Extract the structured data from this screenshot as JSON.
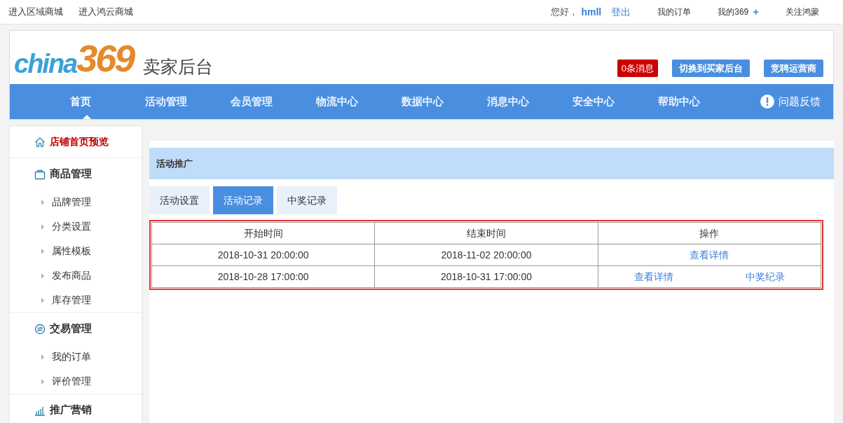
{
  "top_bar": {
    "left_links": [
      "进入区域商城",
      "进入鸿云商城"
    ],
    "greeting": "您好，",
    "username": "hmll",
    "logout": "登出",
    "right_links": [
      {
        "label": "我的订单",
        "plus": false
      },
      {
        "label": "我的369",
        "plus": true
      },
      {
        "label": "关注鸿蒙",
        "plus": false
      }
    ],
    "plus_text": "+"
  },
  "header": {
    "logo": {
      "part_1": "china",
      "part_2": "369"
    },
    "title": "卖家后台",
    "messages": "0条消息",
    "buttons": [
      "切换到买家后台",
      "竞聘运营商"
    ]
  },
  "nav": {
    "items": [
      {
        "label": "首页",
        "selected": true
      },
      {
        "label": "活动管理",
        "selected": false
      },
      {
        "label": "会员管理",
        "selected": false
      },
      {
        "label": "物流中心",
        "selected": false
      },
      {
        "label": "数据中心",
        "selected": false
      },
      {
        "label": "消息中心",
        "selected": false
      },
      {
        "label": "安全中心",
        "selected": false
      },
      {
        "label": "帮助中心",
        "selected": false
      }
    ],
    "feedback": "问题反馈"
  },
  "sidebar": {
    "sections": [
      {
        "kind": "home",
        "label": "店铺首页预览",
        "highlight": true
      },
      {
        "kind": "goods",
        "label": "商品管理",
        "highlight": false,
        "children": [
          "品牌管理",
          "分类设置",
          "属性模板",
          "发布商品",
          "库存管理"
        ]
      },
      {
        "kind": "trade",
        "label": "交易管理",
        "highlight": false,
        "children": [
          "我的订单",
          "评价管理"
        ]
      },
      {
        "kind": "promotion",
        "label": "推广营销",
        "highlight": false
      }
    ]
  },
  "panel": {
    "title": "活动推广",
    "tabs": [
      {
        "label": "活动设置",
        "selected": false
      },
      {
        "label": "活动记录",
        "selected": true
      },
      {
        "label": "中奖记录",
        "selected": false
      }
    ],
    "table": {
      "columns": [
        "开始时间",
        "结束时间",
        "操作"
      ],
      "rows": [
        {
          "start": "2018-10-31 20:00:00",
          "end": "2018-11-02 20:00:00",
          "actions": [
            "查看详情"
          ]
        },
        {
          "start": "2018-10-28 17:00:00",
          "end": "2018-10-31 17:00:00",
          "actions": [
            "查看详情",
            "中奖纪录"
          ]
        }
      ]
    }
  }
}
